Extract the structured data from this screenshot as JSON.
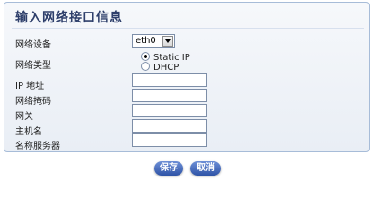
{
  "panel": {
    "title": "输入网络接口信息"
  },
  "form": {
    "interface_label": "网络设备",
    "interface_value": "eth0",
    "type_label": "网络类型",
    "static_ip_option": "Static IP",
    "dhcp_option": "DHCP",
    "ip_label": "IP 地址",
    "mask_label": "网络掩码",
    "gateway_label": "网关",
    "hostname_label": "主机名",
    "dns_label": "名称服务器"
  },
  "buttons": {
    "save": "保存",
    "cancel": "取消"
  }
}
